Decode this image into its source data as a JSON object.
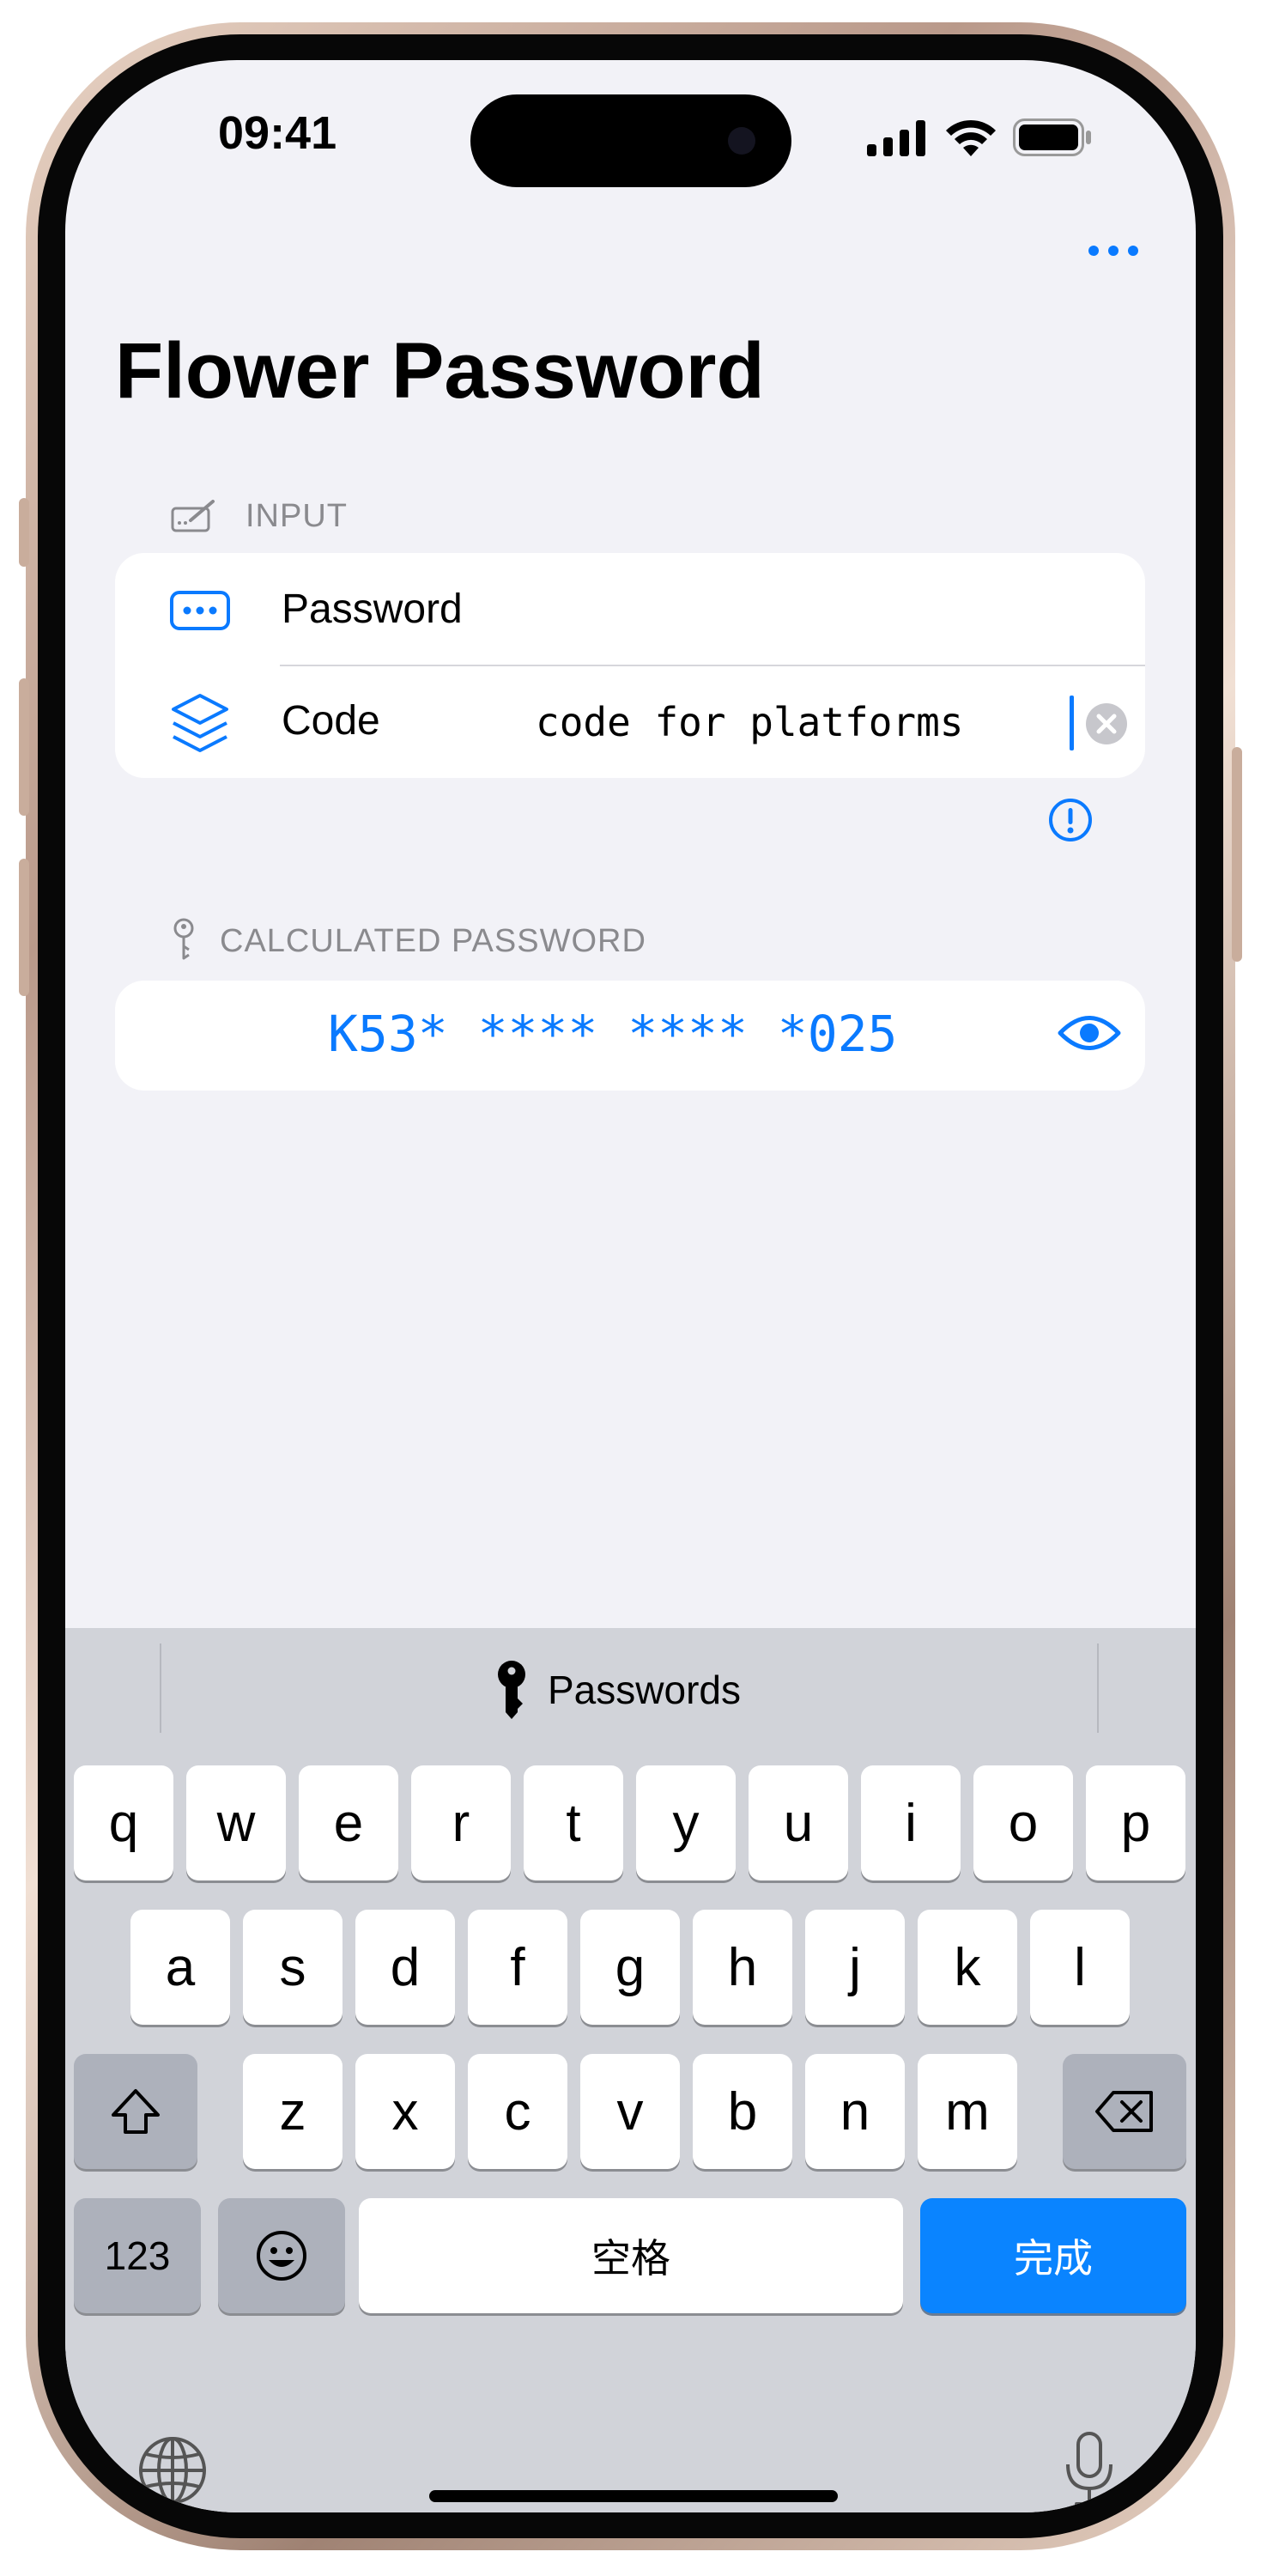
{
  "status_bar": {
    "time": "09:41"
  },
  "nav": {
    "more_icon": "ellipsis-icon"
  },
  "page": {
    "title": "Flower Password"
  },
  "input_section": {
    "label": "INPUT",
    "icon": "pencil-box-icon",
    "rows": [
      {
        "icon": "password-dots-icon",
        "label": "Password",
        "value": ""
      },
      {
        "icon": "layers-icon",
        "label": "Code",
        "value": "code for platforms"
      }
    ],
    "info_icon": "info-circle-icon"
  },
  "result_section": {
    "label": "CALCULATED PASSWORD",
    "icon": "key-icon",
    "value": "K53* **** **** *025",
    "toggle_icon": "eye-icon"
  },
  "keyboard": {
    "suggestion": "Passwords",
    "row1": [
      "q",
      "w",
      "e",
      "r",
      "t",
      "y",
      "u",
      "i",
      "o",
      "p"
    ],
    "row2": [
      "a",
      "s",
      "d",
      "f",
      "g",
      "h",
      "j",
      "k",
      "l"
    ],
    "row3": [
      "z",
      "x",
      "c",
      "v",
      "b",
      "n",
      "m"
    ],
    "numbers_key": "123",
    "space_key": "空格",
    "done_key": "完成"
  },
  "colors": {
    "accent": "#0a7aff",
    "background": "#f2f2f7",
    "keyboard": "#d1d3d9"
  }
}
